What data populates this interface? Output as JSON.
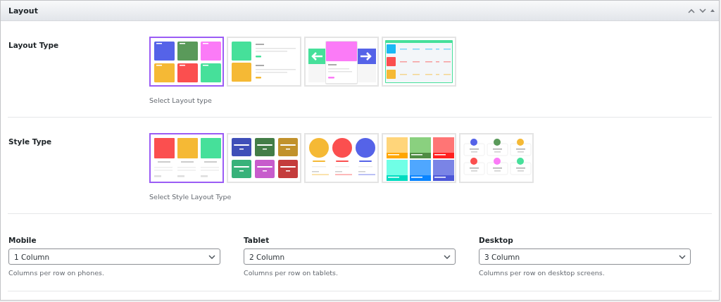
{
  "panel": {
    "title": "Layout"
  },
  "sections": [
    {
      "label": "Layout Type",
      "help": "Select Layout type",
      "options": [
        {
          "kind": "grid",
          "selected": true
        },
        {
          "kind": "list",
          "selected": false
        },
        {
          "kind": "carousel",
          "selected": false
        },
        {
          "kind": "table",
          "selected": false
        }
      ]
    },
    {
      "label": "Style Type",
      "help": "Select Style Layout Type",
      "options": [
        {
          "kind": "cards",
          "selected": true
        },
        {
          "kind": "tiles",
          "selected": false
        },
        {
          "kind": "circles",
          "selected": false
        },
        {
          "kind": "overlay",
          "selected": false
        },
        {
          "kind": "avatars",
          "selected": false
        }
      ]
    }
  ],
  "columns": [
    {
      "label": "Mobile",
      "value": "1 Column",
      "help": "Columns per row on phones."
    },
    {
      "label": "Tablet",
      "value": "2 Column",
      "help": "Columns per row on tablets."
    },
    {
      "label": "Desktop",
      "value": "3 Column",
      "help": "Columns per row on desktop screens."
    }
  ]
}
